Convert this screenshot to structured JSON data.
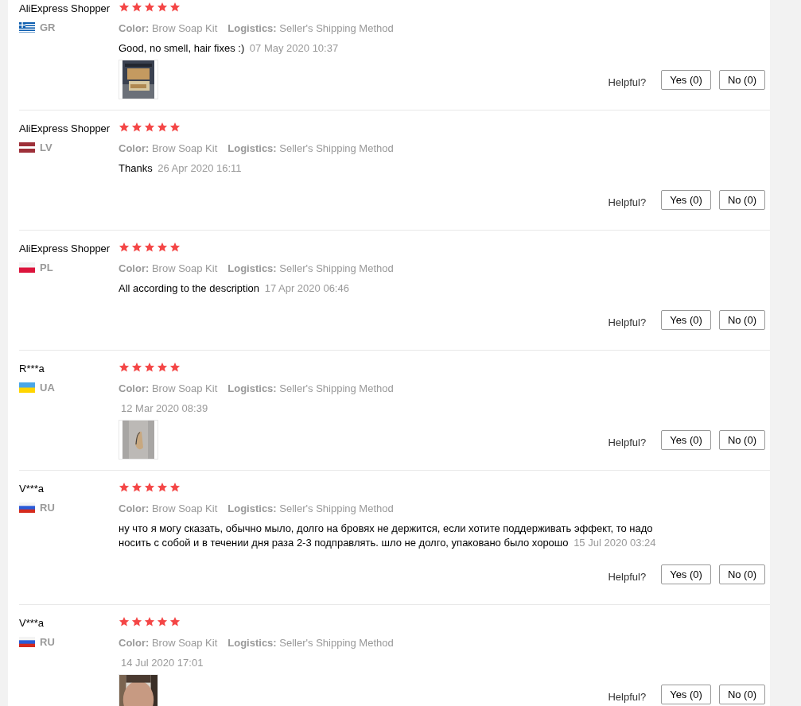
{
  "reviews": [
    {
      "name": "AliExpress Shopper",
      "country": "GR",
      "flag": {
        "kind": "gr"
      },
      "stars": 5,
      "color_label": "Color:",
      "color_value": "Brow Soap Kit",
      "logistics_label": "Logistics:",
      "logistics": "Seller's Shipping Method",
      "comment": "Good, no smell, hair fixes :)",
      "date": "07 May 2020 10:37",
      "photos": [
        {
          "kind": "picture"
        }
      ],
      "helpful": "Helpful?",
      "yes": "Yes (0)",
      "no": "No (0)"
    },
    {
      "name": "AliExpress Shopper",
      "country": "LV",
      "flag": {
        "kind": "lv"
      },
      "stars": 5,
      "color_label": "Color:",
      "color_value": "Brow Soap Kit",
      "logistics_label": "Logistics:",
      "logistics": "Seller's Shipping Method",
      "comment": "Thanks",
      "date": "26 Apr 2020 16:11",
      "helpful": "Helpful?",
      "yes": "Yes (0)",
      "no": "No (0)"
    },
    {
      "name": "AliExpress Shopper",
      "country": "PL",
      "flag": {
        "kind": "pl"
      },
      "stars": 5,
      "color_label": "Color:",
      "color_value": "Brow Soap Kit",
      "logistics_label": "Logistics:",
      "logistics": "Seller's Shipping Method",
      "comment": "All according to the description",
      "date": "17 Apr 2020 06:46",
      "helpful": "Helpful?",
      "yes": "Yes (0)",
      "no": "No (0)"
    },
    {
      "name": "R***a",
      "country": "UA",
      "flag": {
        "kind": "ua"
      },
      "stars": 5,
      "color_label": "Color:",
      "color_value": "Brow Soap Kit",
      "logistics_label": "Logistics:",
      "logistics": "Seller's Shipping Method",
      "date": "12 Mar 2020 08:39",
      "photos": [
        {
          "kind": "picture"
        }
      ],
      "helpful": "Helpful?",
      "yes": "Yes (0)",
      "no": "No (0)"
    },
    {
      "name": "V***a",
      "country": "RU",
      "flag": {
        "kind": "ru"
      },
      "stars": 5,
      "color_label": "Color:",
      "color_value": "Brow Soap Kit",
      "logistics_label": "Logistics:",
      "logistics": "Seller's Shipping Method",
      "comment": "ну что я могу сказать, обычно мыло, долго на бровях не держится, если хотите поддерживать эффект, то надо носить с собой и в течении дня раза 2-3 подправлять. шло не долго, упаковано было хорошо",
      "date": "15 Jul 2020 03:24",
      "helpful": "Helpful?",
      "yes": "Yes (0)",
      "no": "No (0)"
    },
    {
      "name": "V***a",
      "country": "RU",
      "flag": {
        "kind": "ru"
      },
      "stars": 5,
      "color_label": "Color:",
      "color_value": "Brow Soap Kit",
      "logistics_label": "Logistics:",
      "logistics": "Seller's Shipping Method",
      "date": "14 Jul 2020 17:01",
      "photos": [
        {
          "kind": "picture"
        }
      ],
      "helpful": "Helpful?",
      "yes": "Yes (0)",
      "no": "No (0)"
    }
  ]
}
